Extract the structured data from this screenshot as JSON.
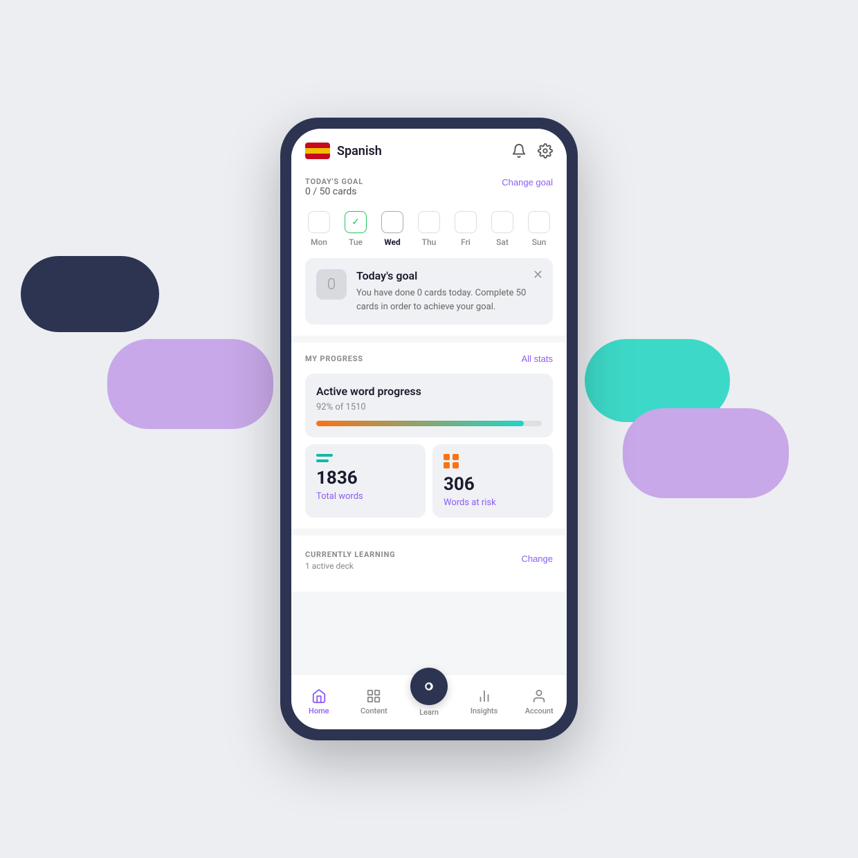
{
  "header": {
    "language": "Spanish",
    "flag_alt": "Spanish flag"
  },
  "today_goal": {
    "title": "TODAY'S GOAL",
    "count": "0 / 50 cards",
    "change_label": "Change goal",
    "days": [
      {
        "id": "mon",
        "label": "Mon",
        "state": "empty"
      },
      {
        "id": "tue",
        "label": "Tue",
        "state": "checked"
      },
      {
        "id": "wed",
        "label": "Wed",
        "state": "active"
      },
      {
        "id": "thu",
        "label": "Thu",
        "state": "empty"
      },
      {
        "id": "fri",
        "label": "Fri",
        "state": "empty"
      },
      {
        "id": "sat",
        "label": "Sat",
        "state": "empty"
      },
      {
        "id": "sun",
        "label": "Sun",
        "state": "empty"
      }
    ],
    "card": {
      "number": "0",
      "title": "Today's goal",
      "description": "You have done 0 cards today. Complete 50 cards in order to achieve your goal."
    }
  },
  "progress": {
    "section_title": "MY PROGRESS",
    "all_stats_label": "All stats",
    "active_word": {
      "title": "Active word progress",
      "percent_text": "92% of 1510",
      "percent_value": 92
    },
    "stats": [
      {
        "id": "total-words",
        "icon_type": "lines",
        "number": "1836",
        "label": "Total words"
      },
      {
        "id": "words-at-risk",
        "icon_type": "grid",
        "number": "306",
        "label": "Words at risk"
      }
    ]
  },
  "currently_learning": {
    "section_title": "CURRENTLY LEARNING",
    "sub_text": "1 active deck",
    "change_label": "Change"
  },
  "bottom_nav": {
    "items": [
      {
        "id": "home",
        "label": "Home",
        "active": true
      },
      {
        "id": "content",
        "label": "Content",
        "active": false
      },
      {
        "id": "learn",
        "label": "Learn",
        "active": false,
        "center": true
      },
      {
        "id": "insights",
        "label": "Insights",
        "active": false
      },
      {
        "id": "account",
        "label": "Account",
        "active": false
      }
    ]
  },
  "icons": {
    "bell": "🔔",
    "gear": "⚙️",
    "close": "✕"
  }
}
